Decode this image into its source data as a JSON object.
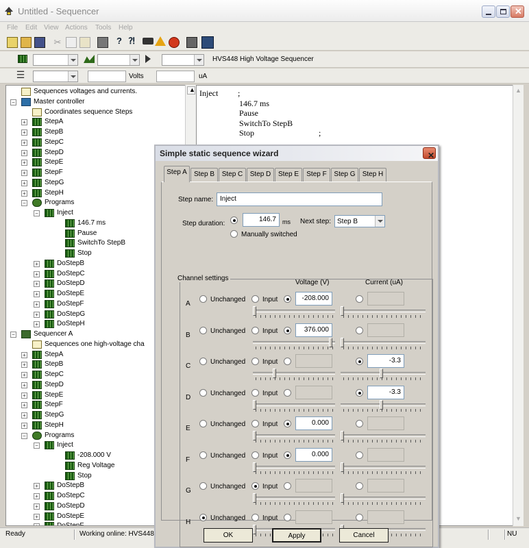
{
  "window": {
    "title": "Untitled - Sequencer",
    "menu": [
      "File",
      "Edit",
      "View",
      "Actions",
      "Tools",
      "Help"
    ]
  },
  "toolbar2": {
    "device_label": "HVS448  High Voltage Sequencer"
  },
  "toolbar3": {
    "volts_unit": "Volts",
    "current_unit": "uA"
  },
  "tree": {
    "items": [
      {
        "label": "Sequences voltages and currents.",
        "icon": "document-icon",
        "level": 1
      },
      {
        "label": "Master controller",
        "icon": "controller-icon",
        "level": 1
      },
      {
        "label": "Coordinates sequence Steps",
        "icon": "document-icon",
        "level": 2
      },
      {
        "label": "StepA",
        "icon": "step-icon",
        "level": 2
      },
      {
        "label": "StepB",
        "icon": "step-icon",
        "level": 2
      },
      {
        "label": "StepC",
        "icon": "step-icon",
        "level": 2
      },
      {
        "label": "StepD",
        "icon": "step-icon",
        "level": 2
      },
      {
        "label": "StepE",
        "icon": "step-icon",
        "level": 2
      },
      {
        "label": "StepF",
        "icon": "step-icon",
        "level": 2
      },
      {
        "label": "StepG",
        "icon": "step-icon",
        "level": 2
      },
      {
        "label": "StepH",
        "icon": "step-icon",
        "level": 2
      },
      {
        "label": "Programs",
        "icon": "programs-icon",
        "level": 2
      },
      {
        "label": "Inject",
        "icon": "step-icon",
        "level": 3
      },
      {
        "label": "146.7 ms",
        "icon": "command-icon",
        "level": 4
      },
      {
        "label": "Pause",
        "icon": "command-icon",
        "level": 4
      },
      {
        "label": "SwitchTo StepB",
        "icon": "command-icon",
        "level": 4
      },
      {
        "label": "Stop",
        "icon": "command-icon",
        "level": 4
      },
      {
        "label": "DoStepB",
        "icon": "step-icon",
        "level": 3
      },
      {
        "label": "DoStepC",
        "icon": "step-icon",
        "level": 3
      },
      {
        "label": "DoStepD",
        "icon": "step-icon",
        "level": 3
      },
      {
        "label": "DoStepE",
        "icon": "step-icon",
        "level": 3
      },
      {
        "label": "DoStepF",
        "icon": "step-icon",
        "level": 3
      },
      {
        "label": "DoStepG",
        "icon": "step-icon",
        "level": 3
      },
      {
        "label": "DoStepH",
        "icon": "step-icon",
        "level": 3
      },
      {
        "label": "Sequencer A",
        "icon": "sequencer-icon",
        "level": 1
      },
      {
        "label": "Sequences one high-voltage cha",
        "icon": "document-icon",
        "level": 2
      },
      {
        "label": "StepA",
        "icon": "step-icon",
        "level": 2
      },
      {
        "label": "StepB",
        "icon": "step-icon",
        "level": 2
      },
      {
        "label": "StepC",
        "icon": "step-icon",
        "level": 2
      },
      {
        "label": "StepD",
        "icon": "step-icon",
        "level": 2
      },
      {
        "label": "StepE",
        "icon": "step-icon",
        "level": 2
      },
      {
        "label": "StepF",
        "icon": "step-icon",
        "level": 2
      },
      {
        "label": "StepG",
        "icon": "step-icon",
        "level": 2
      },
      {
        "label": "StepH",
        "icon": "step-icon",
        "level": 2
      },
      {
        "label": "Programs",
        "icon": "programs-icon",
        "level": 2
      },
      {
        "label": "Inject",
        "icon": "step-icon",
        "level": 3
      },
      {
        "label": "-208.000 V",
        "icon": "command-icon",
        "level": 4
      },
      {
        "label": "Reg Voltage",
        "icon": "command-icon",
        "level": 4
      },
      {
        "label": "Stop",
        "icon": "command-icon",
        "level": 4
      },
      {
        "label": "DoStepB",
        "icon": "step-icon",
        "level": 3
      },
      {
        "label": "DoStepC",
        "icon": "step-icon",
        "level": 3
      },
      {
        "label": "DoStepD",
        "icon": "step-icon",
        "level": 3
      },
      {
        "label": "DoStepE",
        "icon": "step-icon",
        "level": 3
      },
      {
        "label": "DoStepF",
        "icon": "step-icon",
        "level": 3
      }
    ]
  },
  "script": {
    "lines": [
      "Inject",
      ";",
      "146.7 ms",
      "Pause",
      "SwitchTo StepB",
      "Stop",
      ";"
    ]
  },
  "status": {
    "ready": "Ready",
    "online": "Working online: HVS448-",
    "num": "NU"
  },
  "dialog": {
    "title": "Simple static sequence wizard",
    "tabs": [
      "Step A",
      "Step B",
      "Step C",
      "Step D",
      "Step E",
      "Step F",
      "Step G",
      "Step H"
    ],
    "active_tab": "Step A",
    "step_name_label": "Step name:",
    "step_name": "Inject",
    "step_duration_label": "Step duration:",
    "step_duration": "146.7",
    "duration_unit": "ms",
    "next_step_label": "Next step:",
    "next_step": "Step B",
    "manually_switched_label": "Manually switched",
    "channel_settings_label": "Channel settings",
    "voltage_header": "Voltage (V)",
    "current_header": "Current (uA)",
    "unchanged_label": "Unchanged",
    "input_label": "Input",
    "channels": [
      {
        "name": "A",
        "mode": "voltage",
        "voltage": "-208.000",
        "current": "",
        "vslider": 0.0,
        "cslider": 0.0
      },
      {
        "name": "B",
        "mode": "voltage",
        "voltage": "376.000",
        "current": "",
        "vslider": 0.97,
        "cslider": 0.0
      },
      {
        "name": "C",
        "mode": "current",
        "voltage": "",
        "current": "-3.3",
        "vslider": 0.25,
        "cslider": 0.48
      },
      {
        "name": "D",
        "mode": "current",
        "voltage": "",
        "current": "-3.3",
        "vslider": 0.0,
        "cslider": 0.48
      },
      {
        "name": "E",
        "mode": "voltage",
        "voltage": "0.000",
        "current": "",
        "vslider": 0.0,
        "cslider": 0.0
      },
      {
        "name": "F",
        "mode": "voltage",
        "voltage": "0.000",
        "current": "",
        "vslider": 0.0,
        "cslider": 0.0
      },
      {
        "name": "G",
        "mode": "input",
        "voltage": "",
        "current": "",
        "vslider": 0.0,
        "cslider": 0.0
      },
      {
        "name": "H",
        "mode": "unchanged",
        "voltage": "",
        "current": "",
        "vslider": 0.0,
        "cslider": 0.0
      }
    ],
    "buttons": {
      "ok": "OK",
      "apply": "Apply",
      "cancel": "Cancel"
    }
  }
}
